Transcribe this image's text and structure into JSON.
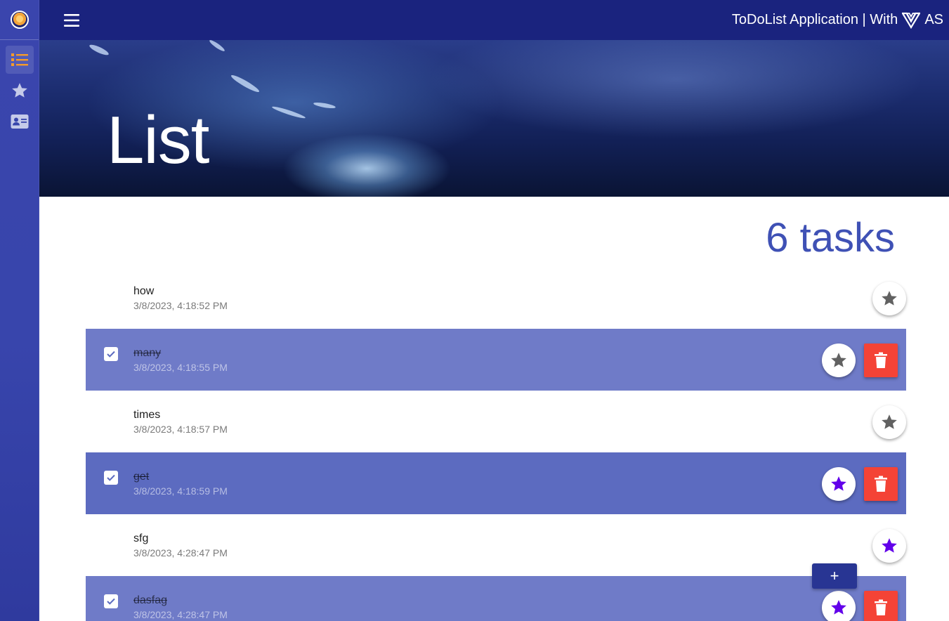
{
  "header": {
    "title": "ToDoList Application | With",
    "brand_suffix": "AS"
  },
  "sidebar": {
    "items": [
      {
        "name": "list",
        "icon": "list-icon"
      },
      {
        "name": "starred",
        "icon": "star-icon"
      },
      {
        "name": "about",
        "icon": "contact-card-icon"
      }
    ]
  },
  "hero": {
    "title": "List"
  },
  "main": {
    "task_count": "6 tasks",
    "tasks": [
      {
        "name": "how",
        "date": "3/8/2023, 4:18:52 PM",
        "done": false,
        "starred": false
      },
      {
        "name": "many",
        "date": "3/8/2023, 4:18:55 PM",
        "done": true,
        "starred": false
      },
      {
        "name": "times",
        "date": "3/8/2023, 4:18:57 PM",
        "done": false,
        "starred": false
      },
      {
        "name": "get",
        "date": "3/8/2023, 4:18:59 PM",
        "done": true,
        "starred": true
      },
      {
        "name": "sfg",
        "date": "3/8/2023, 4:28:47 PM",
        "done": false,
        "starred": true
      },
      {
        "name": "dasfag",
        "date": "3/8/2023, 4:28:47 PM",
        "done": true,
        "starred": true
      }
    ],
    "add_label": "+"
  },
  "colors": {
    "sidebar": "#3845ac",
    "topbar": "#1a237e",
    "accent": "#3f51b5",
    "done_row": "#6f7bc8",
    "delete": "#f44336",
    "star_active": "#6200ea",
    "star_inactive": "#616161",
    "nav_active": "#f59b2a"
  }
}
